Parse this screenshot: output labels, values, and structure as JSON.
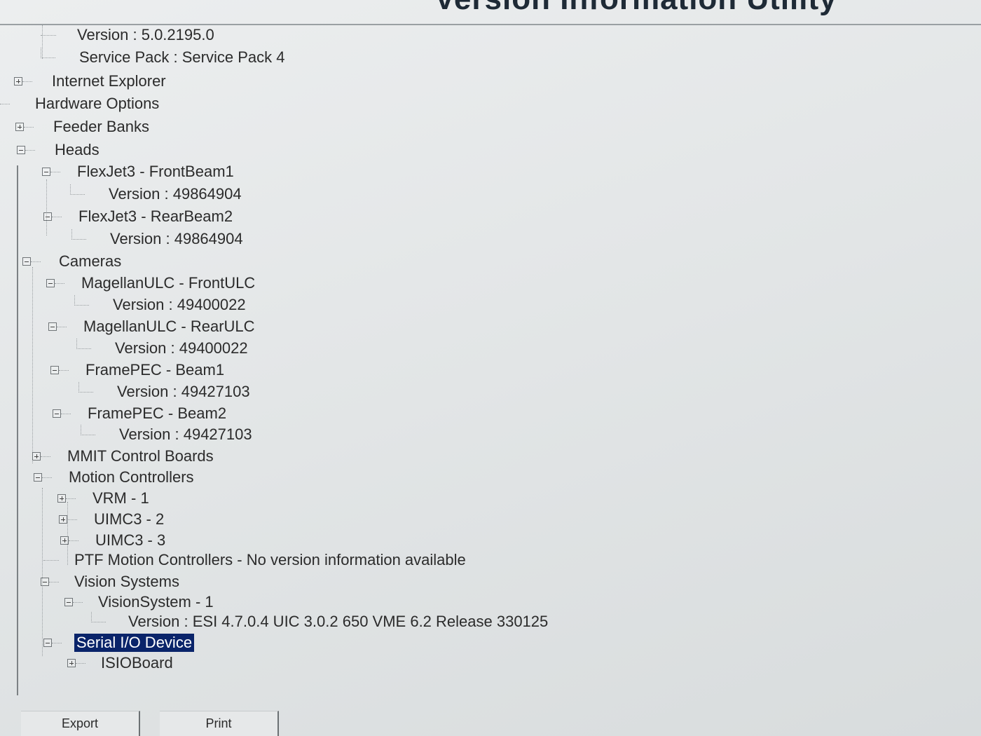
{
  "window": {
    "title": "Version Information Utility"
  },
  "tree": {
    "items": [
      {
        "label": "Version : 5.0.2195.0"
      },
      {
        "label": "Service Pack : Service Pack 4"
      },
      {
        "label": "Internet Explorer"
      },
      {
        "label": "Hardware Options"
      },
      {
        "label": "Feeder Banks"
      },
      {
        "label": "Heads"
      },
      {
        "label": "FlexJet3 - FrontBeam1"
      },
      {
        "label": "Version : 49864904"
      },
      {
        "label": "FlexJet3 - RearBeam2"
      },
      {
        "label": "Version : 49864904"
      },
      {
        "label": "Cameras"
      },
      {
        "label": "MagellanULC - FrontULC"
      },
      {
        "label": "Version : 49400022"
      },
      {
        "label": "MagellanULC - RearULC"
      },
      {
        "label": "Version : 49400022"
      },
      {
        "label": "FramePEC - Beam1"
      },
      {
        "label": "Version : 49427103"
      },
      {
        "label": "FramePEC - Beam2"
      },
      {
        "label": "Version : 49427103"
      },
      {
        "label": "MMIT Control Boards"
      },
      {
        "label": "Motion Controllers"
      },
      {
        "label": "VRM - 1"
      },
      {
        "label": "UIMC3 - 2"
      },
      {
        "label": "UIMC3 - 3"
      },
      {
        "label": "PTF Motion Controllers - No version information available"
      },
      {
        "label": "Vision Systems"
      },
      {
        "label": "VisionSystem - 1"
      },
      {
        "label": "Version : ESI 4.7.0.4 UIC 3.0.2 650 VME  6.2 Release 330125"
      },
      {
        "label": "Serial I/O Device"
      },
      {
        "label": "ISIOBoard"
      }
    ]
  },
  "buttons": {
    "export_label": "Export",
    "print_label": "Print"
  },
  "colors": {
    "selection_background": "#0a246a",
    "selection_text": "#ffffff"
  }
}
